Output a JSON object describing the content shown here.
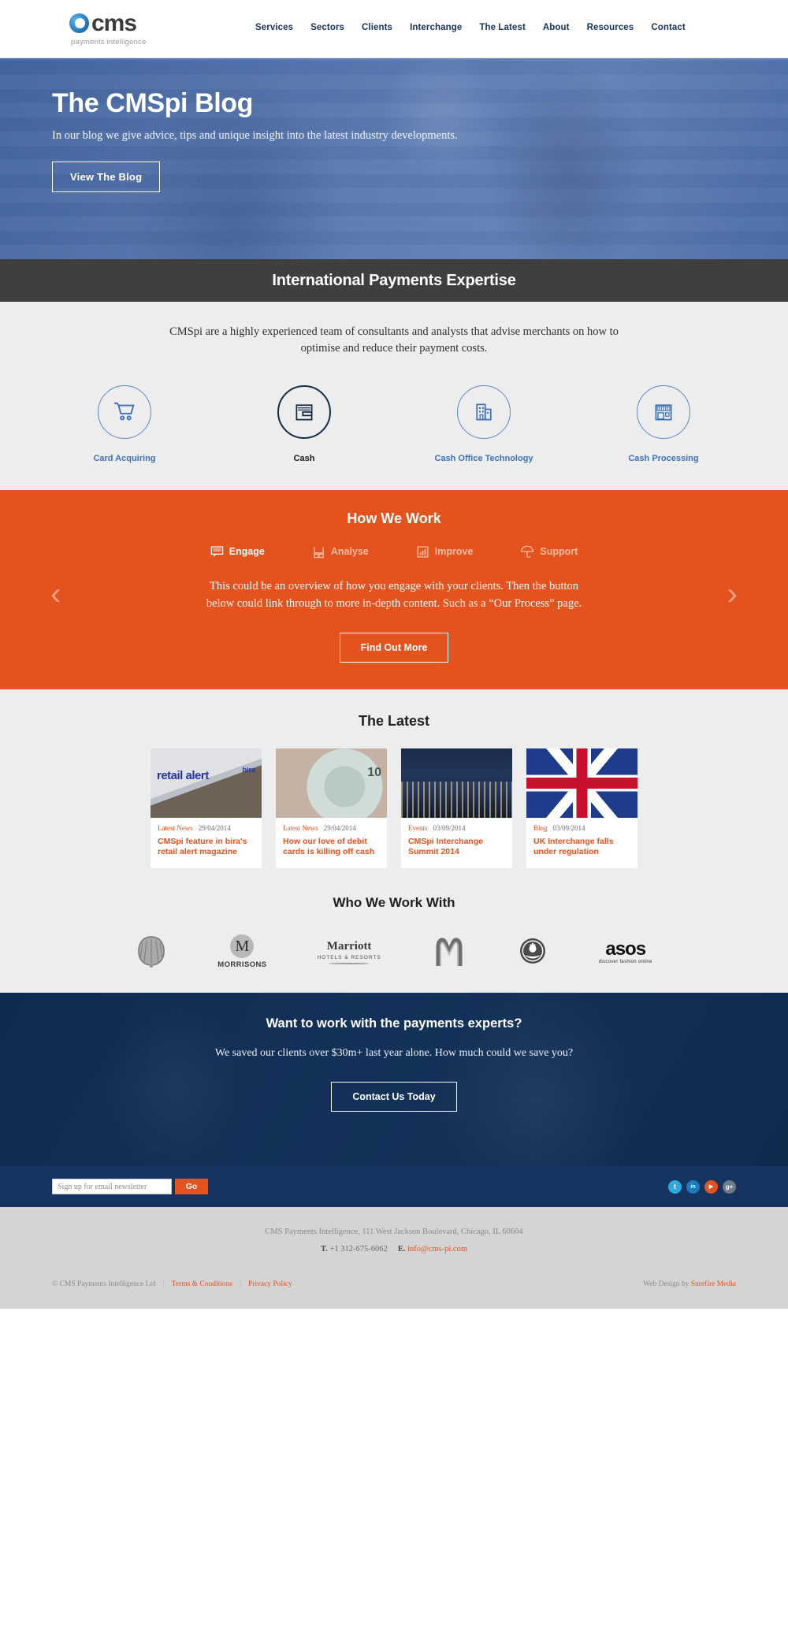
{
  "header": {
    "logo_text": "cms",
    "logo_tagline": "payments intelligence",
    "nav": [
      {
        "label": "Services"
      },
      {
        "label": "Sectors"
      },
      {
        "label": "Clients"
      },
      {
        "label": "Interchange"
      },
      {
        "label": "The Latest"
      },
      {
        "label": "About"
      },
      {
        "label": "Resources"
      },
      {
        "label": "Contact"
      }
    ]
  },
  "hero": {
    "title": "The CMSpi Blog",
    "subtitle": "In our blog we give advice, tips and unique insight into the latest industry developments.",
    "button": "View The Blog"
  },
  "banner": {
    "title": "International Payments Expertise"
  },
  "expertise": {
    "copy": "CMSpi are a highly experienced team of consultants and analysts that advise merchants on how to optimise and reduce their payment costs.",
    "services": [
      {
        "label": "Card Acquiring",
        "icon": "shopping-cart-icon",
        "active": false
      },
      {
        "label": "Cash",
        "icon": "wallet-icon",
        "active": true
      },
      {
        "label": "Cash Office Technology",
        "icon": "office-building-icon",
        "active": false
      },
      {
        "label": "Cash Processing",
        "icon": "storefront-icon",
        "active": false
      }
    ]
  },
  "how_we_work": {
    "title": "How We Work",
    "steps": [
      {
        "label": "Engage",
        "icon": "speech-bubble-icon",
        "active": true
      },
      {
        "label": "Analyse",
        "icon": "chart-columns-icon",
        "active": false
      },
      {
        "label": "Improve",
        "icon": "bar-chart-icon",
        "active": false
      },
      {
        "label": "Support",
        "icon": "umbrella-icon",
        "active": false
      }
    ],
    "copy": "This could be an overview of how you engage with your clients. Then the button below could link through to more in-depth content. Such as a “Our Process” page.",
    "button": "Find Out More",
    "prev_icon": "chevron-left-icon",
    "next_icon": "chevron-right-icon",
    "accent_color": "#e4521d"
  },
  "latest": {
    "title": "The Latest",
    "cards": [
      {
        "category": "Latest News",
        "date": "29/04/2014",
        "title": "CMSpi feature in bira's retail alert magazine",
        "image": "retail-alert-magazine-photo"
      },
      {
        "category": "Latest News",
        "date": "29/04/2014",
        "title": "How our love of debit cards is killing off cash",
        "image": "ten-pound-note-photo"
      },
      {
        "category": "Events",
        "date": "03/09/2014",
        "title": "CMSpi Interchange Summit 2014",
        "image": "london-skyline-photo"
      },
      {
        "category": "Blog",
        "date": "03/09/2014",
        "title": "UK Interchange falls under regulation",
        "image": "union-jack-flag-photo"
      }
    ]
  },
  "clients": {
    "title": "Who We Work With",
    "logos": [
      {
        "name": "Shell",
        "icon": "shell-logo"
      },
      {
        "name": "MORRISONS",
        "icon": "morrisons-logo"
      },
      {
        "name": "Marriott",
        "sub": "HOTELS & RESORTS",
        "icon": "marriott-logo"
      },
      {
        "name": "McDonald's",
        "icon": "mcdonalds-logo"
      },
      {
        "name": "Starbucks",
        "icon": "starbucks-logo"
      },
      {
        "name": "asos",
        "sub": "discover fashion online",
        "icon": "asos-logo"
      }
    ]
  },
  "cta": {
    "title": "Want to work with the payments experts?",
    "subtitle": "We saved our clients over $30m+ last year alone. How much could we save you?",
    "button": "Contact Us Today"
  },
  "signup": {
    "placeholder": "Sign up for email newsletter",
    "value": "",
    "button": "Go",
    "socials": [
      {
        "name": "twitter-icon",
        "glyph": "t",
        "color": "#2fa8e0"
      },
      {
        "name": "linkedin-icon",
        "glyph": "in",
        "color": "#1b7bb9"
      },
      {
        "name": "youtube-icon",
        "glyph": "▶",
        "color": "#e4521d"
      },
      {
        "name": "google-plus-icon",
        "glyph": "g+",
        "color": "#6d7b86"
      }
    ]
  },
  "footer": {
    "address": "CMS Payments Intelligence, 111 West Jackson Boulevard, Chicago, IL 60604",
    "phone_label": "T.",
    "phone": "+1 312-675-6062",
    "email_label": "E.",
    "email": "info@cms-pi.com",
    "copyright": "© CMS Payments Intelligence Ltd",
    "terms": "Terms & Conditions",
    "privacy": "Privacy Policy",
    "credit_prefix": "Web Design by ",
    "credit_link": "Surefire Media"
  }
}
